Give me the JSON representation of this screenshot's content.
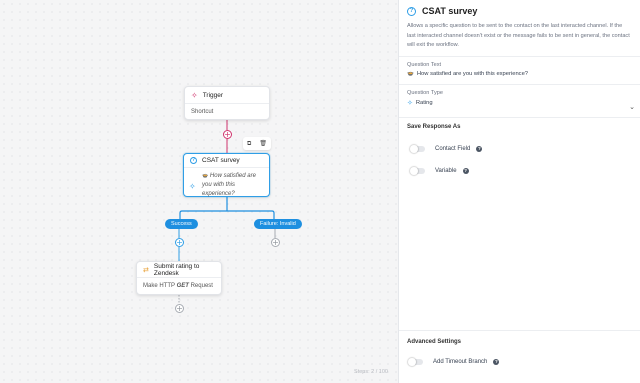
{
  "canvas": {
    "trigger": {
      "title": "Trigger",
      "subtitle": "Shortcut"
    },
    "csat_node": {
      "title": "CSAT survey",
      "question": "How satisfied are you with this experience?",
      "emoji": "🍲"
    },
    "branches": {
      "success": "Success",
      "failure": "Failure: Invalid"
    },
    "zendesk_node": {
      "title": "Submit rating to Zendesk",
      "body_prefix": "Make HTTP",
      "method": "GET",
      "body_suffix": "Request"
    },
    "steps": "Steps: 2 / 100",
    "toolbar": {
      "copy_icon": "copy-icon",
      "delete_icon": "trash-icon"
    },
    "colors": {
      "pink": "#d0346d",
      "blue": "#2f9ee6",
      "pill": "#1e8fe0"
    }
  },
  "panel": {
    "title": "CSAT survey",
    "description": "Allows a specific question to be sent to the contact on the last interacted channel. If the last interacted channel doesn't exist or the message fails to be sent in general, the contact will exit the workflow.",
    "question_text_label": "Question Text",
    "question_text_value": "How satisfied are you with this experience?",
    "question_emoji": "🍲",
    "question_type_label": "Question Type",
    "question_type_value": "Rating",
    "save_response_label": "Save Response As",
    "contact_field_label": "Contact Field",
    "variable_label": "Variable",
    "advanced_label": "Advanced Settings",
    "timeout_label": "Add Timeout Branch"
  }
}
